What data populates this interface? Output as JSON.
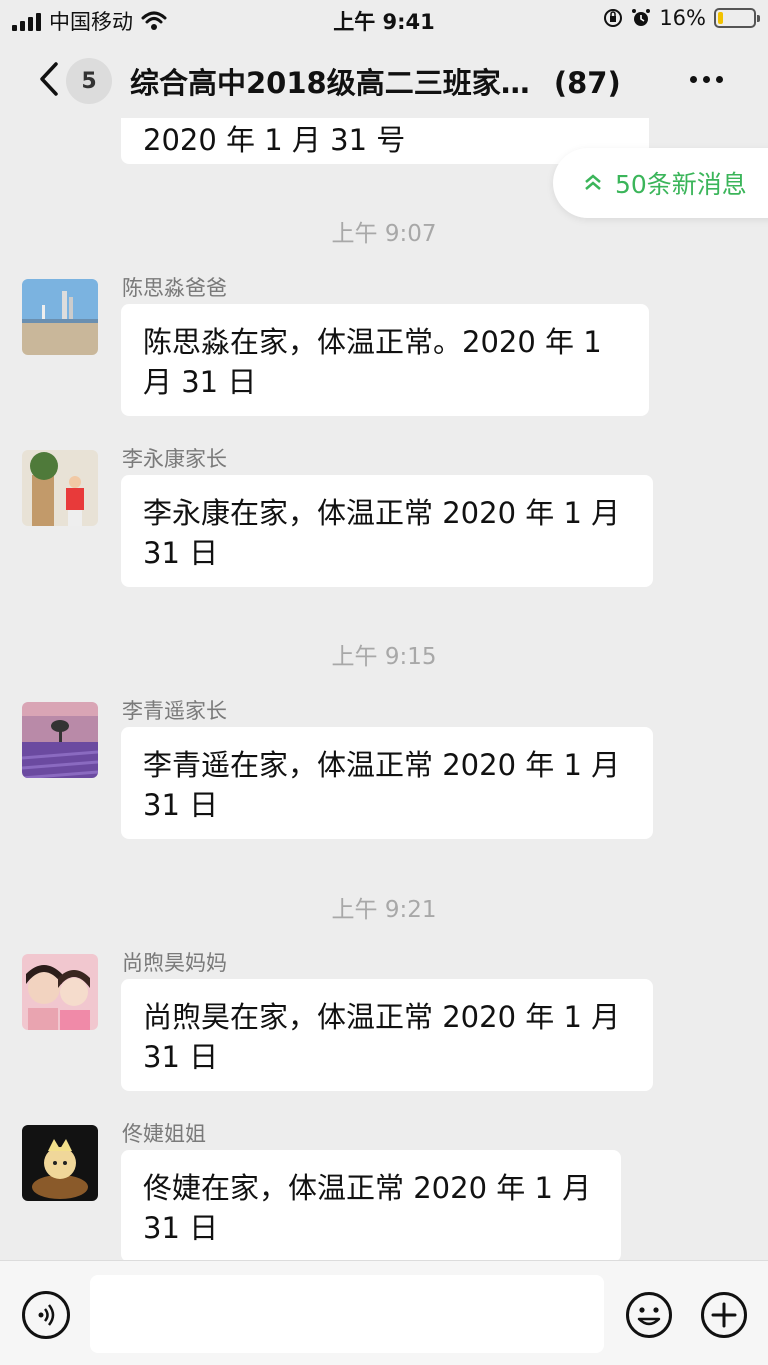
{
  "status_bar": {
    "carrier": "中国移动",
    "time": "上午 9:41",
    "battery": "16%",
    "battery_level": 0.16,
    "icons": [
      "signal-icon",
      "wifi-icon",
      "orientation-lock-icon",
      "alarm-icon",
      "battery-icon"
    ]
  },
  "nav": {
    "unread_count": "5",
    "title": "综合高中2018级高二三班家…",
    "member_count": "(87)",
    "icons": [
      "back-chevron-icon",
      "more-icon"
    ]
  },
  "new_messages": "50条新消息",
  "messages": {
    "prev_partial": "2020 年 1 月 31 号",
    "ts1": "上午 9:07",
    "m1": {
      "sender": "陈思淼爸爸",
      "line1": "陈思淼在家，体温正常。2020 年 1",
      "line2": "月 31 日"
    },
    "m2": {
      "sender": "李永康家长",
      "line1": "李永康在家，体温正常 2020 年 1 月",
      "line2": "31 日"
    },
    "ts2": "上午 9:15",
    "m3": {
      "sender": "李青遥家长",
      "line1": "李青遥在家，体温正常 2020 年 1 月",
      "line2": "31 日"
    },
    "ts3": "上午 9:21",
    "m4": {
      "sender": "尚煦昊妈妈",
      "line1": "尚煦昊在家，体温正常 2020 年 1 月",
      "line2": "31 日"
    },
    "m5": {
      "sender": "佟婕姐姐",
      "line1": "佟婕在家，体温正常 2020 年 1 月",
      "line2": "31 日"
    }
  },
  "input_bar": {
    "message_value": "",
    "icons": [
      "voice-icon",
      "emoji-icon",
      "add-icon"
    ]
  },
  "colors": {
    "background": "#ededed",
    "bubble": "#ffffff",
    "accent_green": "#3bb55a",
    "timestamp": "#a8a8a8"
  }
}
